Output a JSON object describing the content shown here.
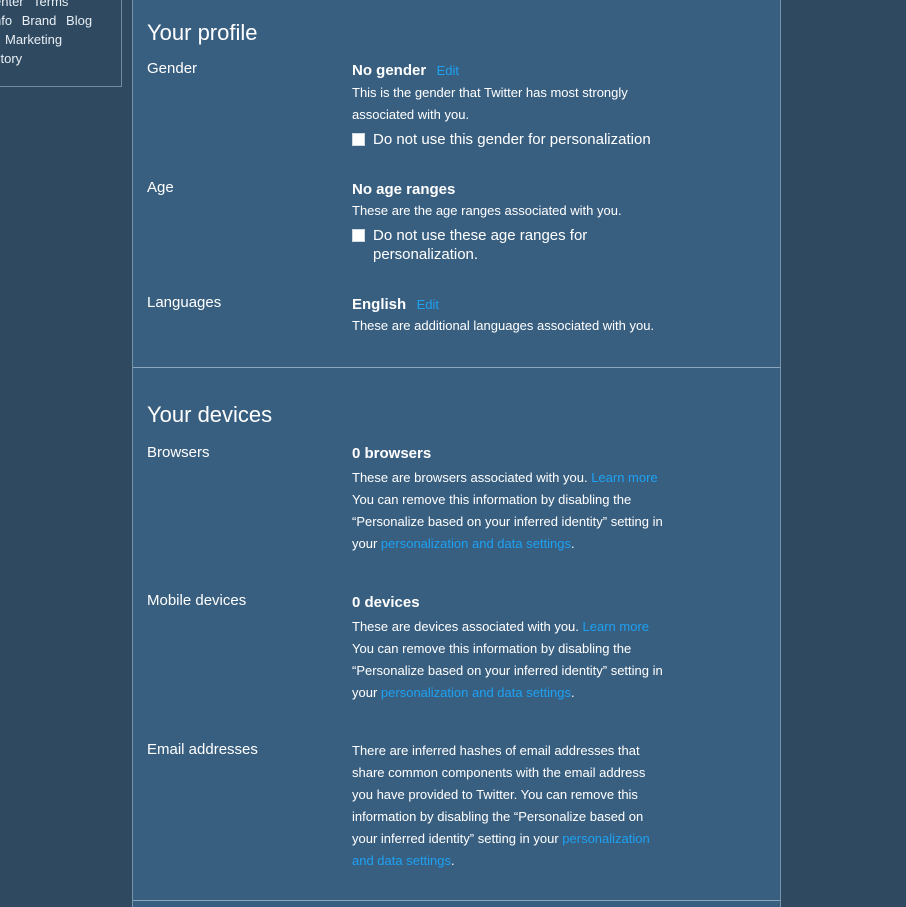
{
  "footer_nav": {
    "line1": [
      "enter",
      "Terms"
    ],
    "line2": [
      "nfo",
      "Brand",
      "Blog"
    ],
    "line3": [
      "Marketing"
    ],
    "line4": [
      "ctory"
    ]
  },
  "profile": {
    "title": "Your profile",
    "gender": {
      "label": "Gender",
      "value": "No gender",
      "edit": "Edit",
      "desc": "This is the gender that Twitter has most strongly associated with you.",
      "checkbox": "Do not use this gender for personalization"
    },
    "age": {
      "label": "Age",
      "value": "No age ranges",
      "desc": "These are the age ranges associated with you.",
      "checkbox": "Do not use these age ranges for personalization."
    },
    "languages": {
      "label": "Languages",
      "value": "English",
      "edit": "Edit",
      "desc": "These are additional languages associated with you."
    }
  },
  "devices": {
    "title": "Your devices",
    "browsers": {
      "label": "Browsers",
      "value": "0 browsers",
      "desc": "These are browsers associated with you.",
      "learn_more": "Learn more",
      "desc2": "You can remove this information by disabling the “Personalize based on your inferred identity” setting in your",
      "settings_link": "personalization and data settings",
      "end": "."
    },
    "mobile": {
      "label": "Mobile devices",
      "value": "0 devices",
      "desc": "These are devices associated with you.",
      "learn_more": "Learn more",
      "desc2": "You can remove this information by disabling the “Personalize based on your inferred identity” setting in your",
      "settings_link": "personalization and data settings",
      "end": "."
    },
    "email": {
      "label": "Email addresses",
      "desc": "There are inferred hashes of email addresses that share common components with the email address you have provided to Twitter. You can remove this information by disabling the “Personalize based on your inferred identity” setting in your",
      "settings_link": "personalization and data settings",
      "end": "."
    }
  },
  "colors": {
    "background": "#2f4a60",
    "panel": "#395f80",
    "link": "#1da1f2"
  }
}
